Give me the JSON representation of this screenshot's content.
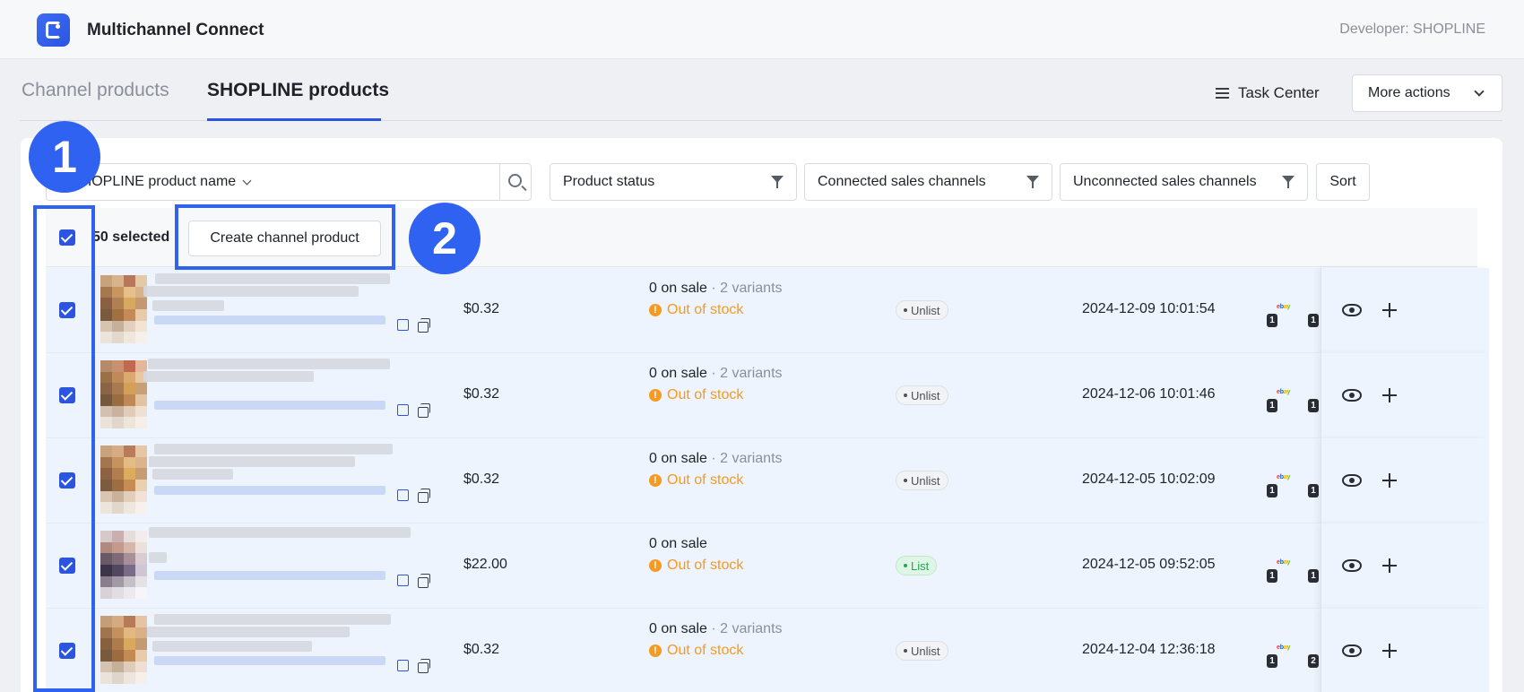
{
  "header": {
    "app_title": "Multichannel Connect",
    "developer": "Developer: SHOPLINE"
  },
  "tabs": [
    {
      "label": "Channel products",
      "active": false
    },
    {
      "label": "SHOPLINE products",
      "active": true
    }
  ],
  "toolbar": {
    "task_center": "Task Center",
    "more_actions": "More actions"
  },
  "filters": {
    "search_field": "SHOPLINE product name",
    "search_placeholder": "",
    "product_status": "Product status",
    "connected": "Connected sales channels",
    "unconnected": "Unconnected sales channels",
    "sort": "Sort"
  },
  "selection": {
    "count_text": "50 selected",
    "create_button": "Create channel product"
  },
  "rows": [
    {
      "price": "$0.32",
      "on_sale": "0 on sale",
      "variants": " · 2 variants",
      "stock": "Out of stock",
      "status": "Unlist",
      "date": "2024-12-09 10:01:54",
      "count_a": "1",
      "count_b": "1"
    },
    {
      "price": "$0.32",
      "on_sale": "0 on sale",
      "variants": " · 2 variants",
      "stock": "Out of stock",
      "status": "Unlist",
      "date": "2024-12-06 10:01:46",
      "count_a": "1",
      "count_b": "1"
    },
    {
      "price": "$0.32",
      "on_sale": "0 on sale",
      "variants": " · 2 variants",
      "stock": "Out of stock",
      "status": "Unlist",
      "date": "2024-12-05 10:02:09",
      "count_a": "1",
      "count_b": "1"
    },
    {
      "price": "$22.00",
      "on_sale": "0 on sale",
      "variants": "",
      "stock": "Out of stock",
      "status": "List",
      "date": "2024-12-05 09:52:05",
      "count_a": "1",
      "count_b": "1"
    },
    {
      "price": "$0.32",
      "on_sale": "0 on sale",
      "variants": " · 2 variants",
      "stock": "Out of stock",
      "status": "Unlist",
      "date": "2024-12-04 12:36:18",
      "count_a": "1",
      "count_b": "2"
    }
  ],
  "ebay_logo": "ebay",
  "annotations": {
    "marker_1": "1",
    "marker_2": "2"
  },
  "colors": {
    "accent": "#2b55e0",
    "warning": "#f59a23",
    "success": "#22a555"
  }
}
